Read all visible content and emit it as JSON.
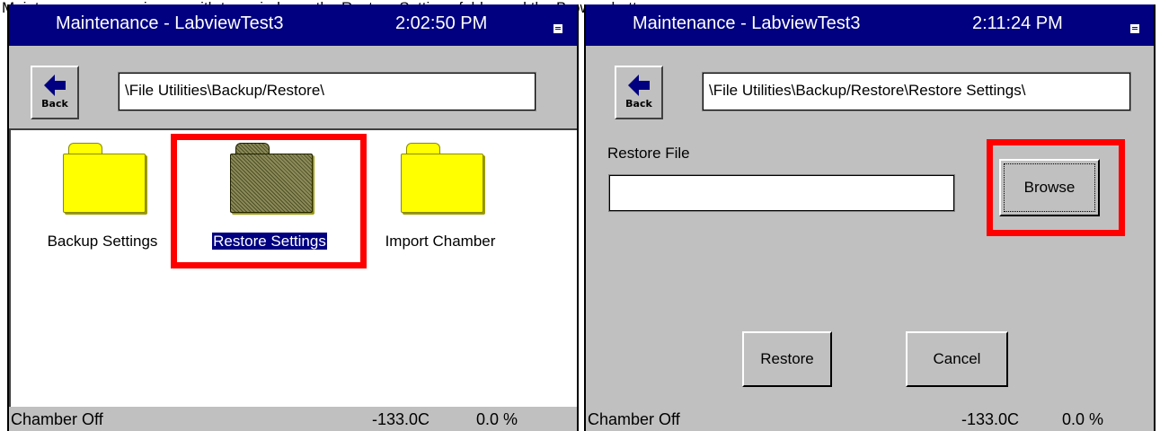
{
  "page_header": "Maintenance screen image with two windows: the Restore Settings folder and the Browse button",
  "left_screen": {
    "title": "Maintenance - LabviewTest3",
    "time": "2:02:50 PM",
    "back_label": "Back",
    "path": "\\File Utilities\\Backup/Restore\\",
    "folders": [
      {
        "label": "Backup Settings",
        "icon": "folder-icon"
      },
      {
        "label": "Restore Settings",
        "icon": "folder-icon",
        "selected": true
      },
      {
        "label": "Import Chamber",
        "icon": "folder-icon"
      }
    ],
    "status": {
      "text": "Chamber Off",
      "temperature": "-133.0C",
      "percent": "0.0 %"
    }
  },
  "right_screen": {
    "title": "Maintenance - LabviewTest3",
    "time": "2:11:24 PM",
    "back_label": "Back",
    "path": "\\File Utilities\\Backup/Restore\\Restore Settings\\",
    "restore_file_label": "Restore File",
    "restore_file_value": "",
    "browse_label": "Browse",
    "restore_label": "Restore",
    "cancel_label": "Cancel",
    "status": {
      "text": "Chamber Off",
      "temperature": "-133.0C",
      "percent": "0.0 %"
    }
  },
  "colors": {
    "titlebar": "#000080",
    "background": "#c0c0c0",
    "folder": "#ffff00",
    "highlight": "#ff0000"
  }
}
